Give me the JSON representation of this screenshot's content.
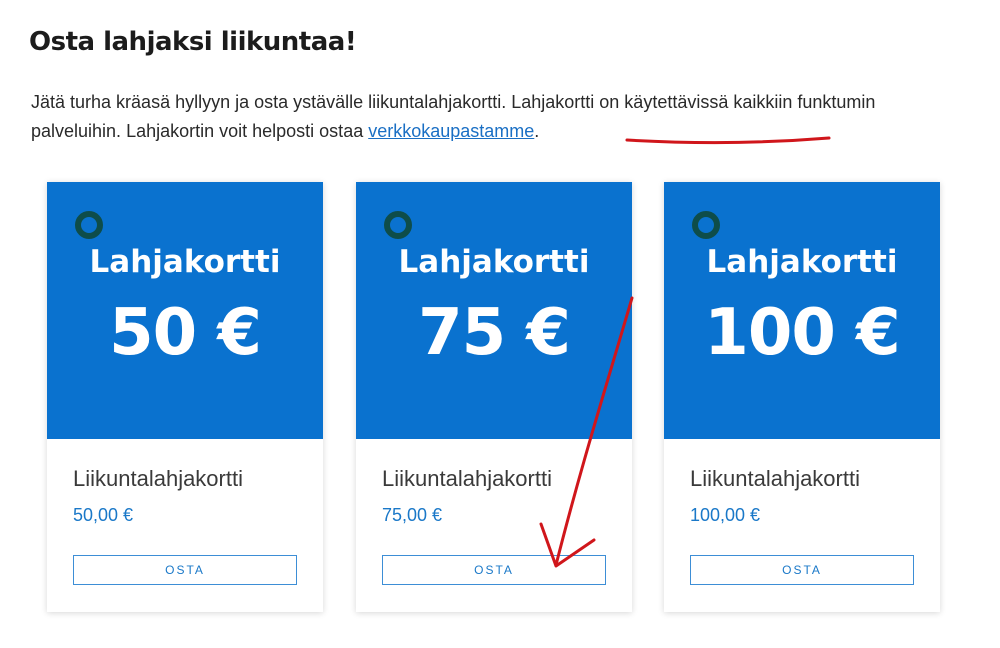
{
  "heading": "Osta lahjaksi liikuntaa!",
  "intro": {
    "text": "Jätä turha kräasä hyllyyn ja osta ystävälle liikuntalahjakortti. Lahjakortti on käytettävissä kaikkiin funktumin palveluihin. Lahjakortin voit helposti ostaa ",
    "link": "verkkokaupastamme",
    "after": "."
  },
  "cards": [
    {
      "image_label": "Lahjakortti",
      "image_amount": "50 €",
      "name": "Liikuntalahjakortti",
      "price": "50,00 €",
      "button": "OSTA"
    },
    {
      "image_label": "Lahjakortti",
      "image_amount": "75 €",
      "name": "Liikuntalahjakortti",
      "price": "75,00 €",
      "button": "OSTA"
    },
    {
      "image_label": "Lahjakortti",
      "image_amount": "100 €",
      "name": "Liikuntalahjakortti",
      "price": "100,00 €",
      "button": "OSTA"
    }
  ],
  "colors": {
    "card_blue": "#0a72cf",
    "ring": "#0e4d4a",
    "link": "#1a6fc4",
    "price": "#1a78c8",
    "annotation": "#d0161b"
  }
}
